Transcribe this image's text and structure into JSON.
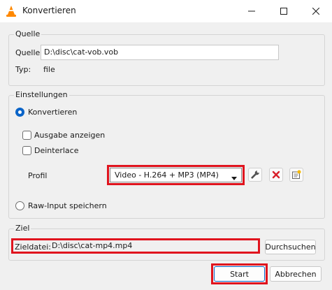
{
  "window": {
    "title": "Konvertieren"
  },
  "source": {
    "legend": "Quelle",
    "source_label": "Quelle:",
    "source_value": "D:\\disc\\cat-vob.vob",
    "type_label": "Typ:",
    "type_value": "file"
  },
  "settings": {
    "legend": "Einstellungen",
    "convert_label": "Konvertieren",
    "show_output_label": "Ausgabe anzeigen",
    "deinterlace_label": "Deinterlace",
    "profile_label": "Profil",
    "profile_value": "Video - H.264 + MP3 (MP4)",
    "raw_input_label": "Raw-Input speichern"
  },
  "target": {
    "legend": "Ziel",
    "file_label": "Zieldatei:",
    "file_value": "D:\\disc\\cat-mp4.mp4",
    "browse_label": "Durchsuchen"
  },
  "footer": {
    "start_label": "Start",
    "cancel_label": "Abbrechen"
  },
  "colors": {
    "accent": "#0a64c8",
    "highlight": "#e0141e",
    "vlc_orange": "#ff8800"
  },
  "icons": {
    "app": "vlc-cone-icon",
    "minimize": "minimize-icon",
    "maximize": "maximize-icon",
    "close": "close-icon",
    "edit_profile": "wrench-icon",
    "delete_profile": "red-x-icon",
    "new_profile": "new-profile-icon"
  }
}
